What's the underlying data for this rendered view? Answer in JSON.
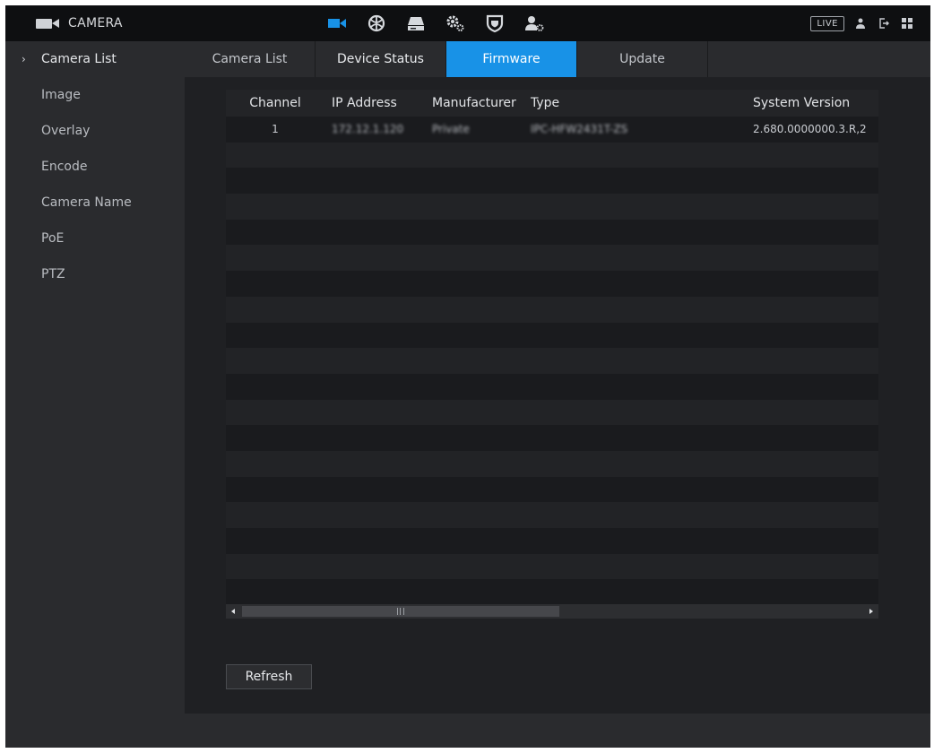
{
  "app": {
    "title": "CAMERA"
  },
  "topbar": {
    "icons": [
      "camera-icon",
      "network-icon",
      "storage-icon",
      "system-settings-icon",
      "security-icon",
      "account-icon"
    ],
    "live_label": "LIVE",
    "right_icons": [
      "user-icon",
      "logout-icon",
      "grid-icon"
    ]
  },
  "sidebar": {
    "items": [
      {
        "label": "Camera List",
        "active": true
      },
      {
        "label": "Image"
      },
      {
        "label": "Overlay"
      },
      {
        "label": "Encode"
      },
      {
        "label": "Camera Name"
      },
      {
        "label": "PoE"
      },
      {
        "label": "PTZ"
      }
    ]
  },
  "tabs": [
    {
      "label": "Camera List"
    },
    {
      "label": "Device Status"
    },
    {
      "label": "Firmware",
      "active": true
    },
    {
      "label": "Update"
    }
  ],
  "table": {
    "columns": [
      "Channel",
      "IP Address",
      "Manufacturer",
      "Type",
      "System Version"
    ],
    "rows": [
      {
        "channel": "1",
        "ip": "172.12.1.120",
        "manufacturer": "Private",
        "type": "IPC-HFW2431T-ZS",
        "system_version": "2.680.0000000.3.R,2"
      }
    ]
  },
  "refresh_label": "Refresh",
  "colors": {
    "accent": "#1892e7",
    "background": "#1f2023",
    "sidebar": "#2a2b2e"
  }
}
